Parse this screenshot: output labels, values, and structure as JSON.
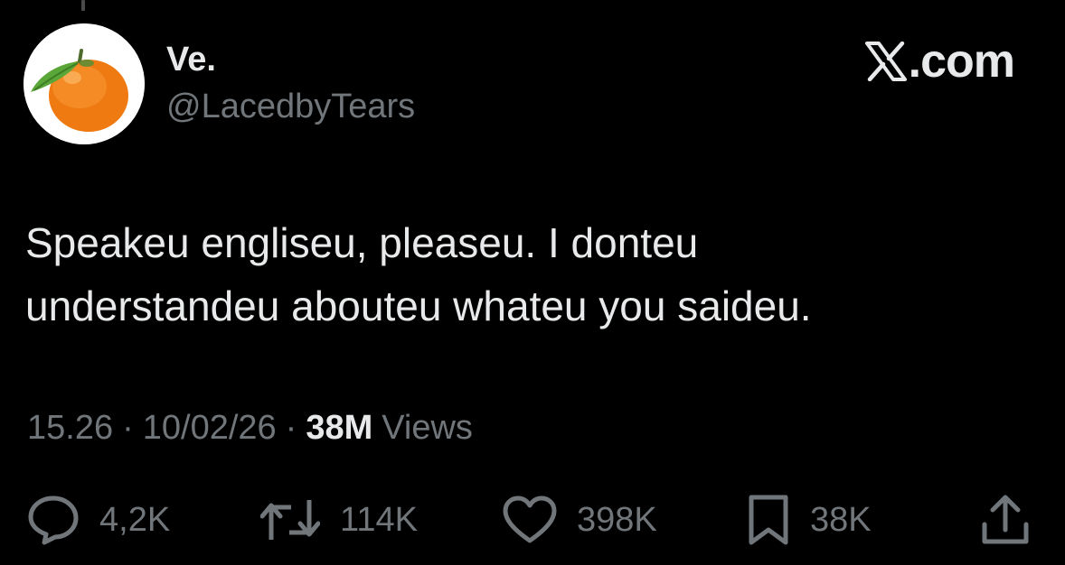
{
  "author": {
    "display_name": "Ve.",
    "handle": "@LacedbyTears",
    "avatar_icon": "tangerine-avatar"
  },
  "brand": {
    "logo_icon": "x-logo-icon",
    "domain": ".com"
  },
  "tweet": {
    "lines": [
      "Speakeu engliseu, pleaseu. I donteu",
      "understandeu abouteu whateu you saideu."
    ]
  },
  "meta": {
    "time": "15.26",
    "separator": "·",
    "date": "10/02/26",
    "views_count": "38M",
    "views_label": "Views"
  },
  "actions": {
    "replies": "4,2K",
    "reposts": "114K",
    "likes": "398K",
    "bookmarks": "38K"
  },
  "colors": {
    "background": "#000000",
    "primary_text": "#e7e9ea",
    "secondary_text": "#71767b",
    "avatar_orange": "#f07a12",
    "leaf_green": "#5aa637"
  }
}
